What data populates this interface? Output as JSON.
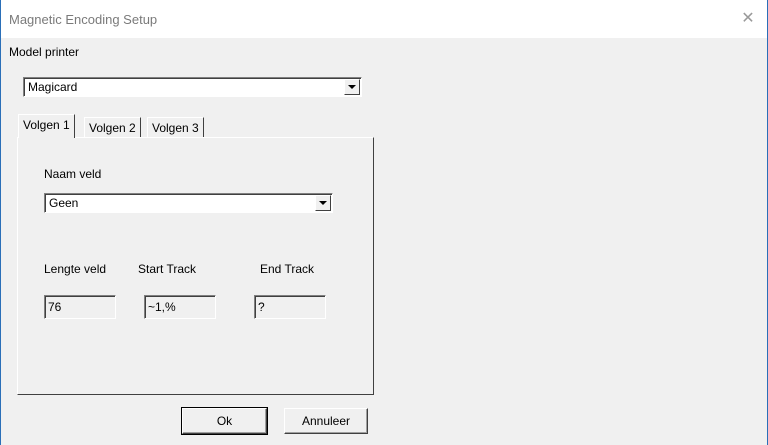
{
  "window": {
    "title": "Magnetic Encoding Setup",
    "close_glyph": "✕",
    "close_icon": "close-icon"
  },
  "model": {
    "label": "Model printer",
    "selected": "Magicard"
  },
  "tabs": [
    {
      "label": "Volgen 1",
      "active": true
    },
    {
      "label": "Volgen 2",
      "active": false
    },
    {
      "label": "Volgen 3",
      "active": false
    }
  ],
  "panel": {
    "field_name_label": "Naam veld",
    "field_name_selected": "Geen",
    "length_label": "Lengte veld",
    "start_label": "Start Track",
    "end_label": "End Track",
    "length_value": "76",
    "start_value": "~1,%",
    "end_value": "?"
  },
  "buttons": {
    "ok": "Ok",
    "cancel": "Annuleer"
  }
}
